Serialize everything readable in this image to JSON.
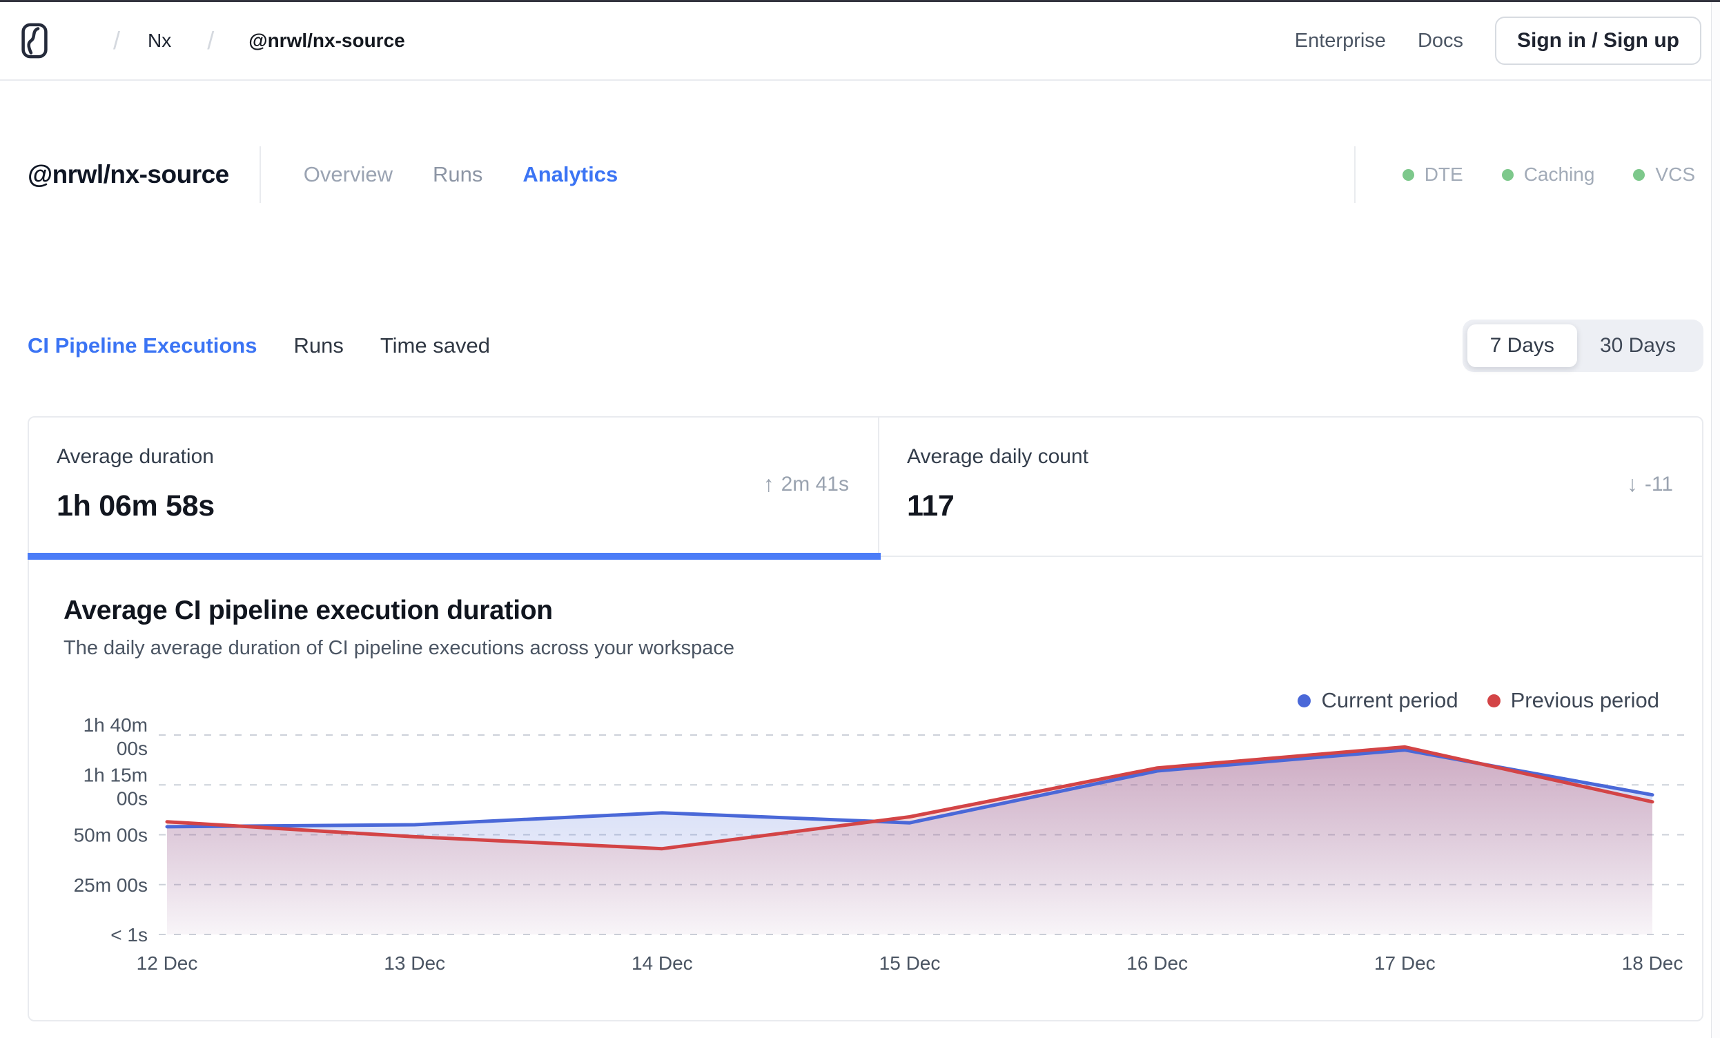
{
  "colors": {
    "accent_blue": "#3b74f4",
    "active_bar_blue": "#4b7cf7",
    "status_green": "#7dc88b",
    "current_line": "#4a68d8",
    "previous_line": "#d34446"
  },
  "topbar": {
    "logo": "nx-cloud-logo",
    "breadcrumb": {
      "separator": "/",
      "items": [
        "Nx",
        "@nrwl/nx-source"
      ]
    },
    "links": [
      {
        "label": "Enterprise"
      },
      {
        "label": "Docs"
      }
    ],
    "signin_button": "Sign in / Sign up"
  },
  "workspace_header": {
    "title": "@nrwl/nx-source",
    "tabs": [
      {
        "label": "Overview",
        "active": false
      },
      {
        "label": "Runs",
        "active": false
      },
      {
        "label": "Analytics",
        "active": true
      }
    ],
    "statuses": [
      {
        "label": "DTE"
      },
      {
        "label": "Caching"
      },
      {
        "label": "VCS"
      }
    ]
  },
  "analytics_nav": {
    "tabs": [
      {
        "label": "CI Pipeline Executions",
        "active": true
      },
      {
        "label": "Runs",
        "active": false
      },
      {
        "label": "Time saved",
        "active": false
      }
    ],
    "range_toggle": {
      "options": [
        {
          "label": "7 Days",
          "selected": true
        },
        {
          "label": "30 Days",
          "selected": false
        }
      ]
    }
  },
  "stat_cards": [
    {
      "label": "Average duration",
      "value": "1h 06m 58s",
      "delta": "2m 41s",
      "delta_direction": "up",
      "active": true
    },
    {
      "label": "Average daily count",
      "value": "117",
      "delta": "-11",
      "delta_direction": "down",
      "active": false
    }
  ],
  "chart_card": {
    "title": "Average CI pipeline execution duration",
    "subtitle": "The daily average duration of CI pipeline executions across your workspace"
  },
  "chart_data": {
    "type": "area",
    "title": "Average CI pipeline execution duration",
    "categories": [
      "12 Dec",
      "13 Dec",
      "14 Dec",
      "15 Dec",
      "16 Dec",
      "17 Dec",
      "18 Dec"
    ],
    "unit": "minutes",
    "series": [
      {
        "name": "Current period",
        "color": "#4a68d8",
        "values": [
          54,
          55,
          61,
          56,
          82,
          92.5,
          70
        ]
      },
      {
        "name": "Previous period",
        "color": "#d34446",
        "values": [
          56.5,
          49,
          43,
          59,
          83.5,
          94,
          66.5
        ]
      }
    ],
    "yticks": [
      {
        "value": 0,
        "label": "< 1s",
        "lines": [
          "< 1s"
        ]
      },
      {
        "value": 25,
        "label": "25m 00s",
        "lines": [
          "25m 00s"
        ]
      },
      {
        "value": 50,
        "label": "50m 00s",
        "lines": [
          "50m 00s"
        ]
      },
      {
        "value": 75,
        "label": "1h 15m 00s",
        "lines": [
          "1h 15m",
          "00s"
        ]
      },
      {
        "value": 100,
        "label": "1h 40m 00s",
        "lines": [
          "1h 40m",
          "00s"
        ]
      }
    ],
    "ylim": [
      0,
      105
    ],
    "grid": "horizontal-dashed",
    "legend_position": "top-right"
  }
}
